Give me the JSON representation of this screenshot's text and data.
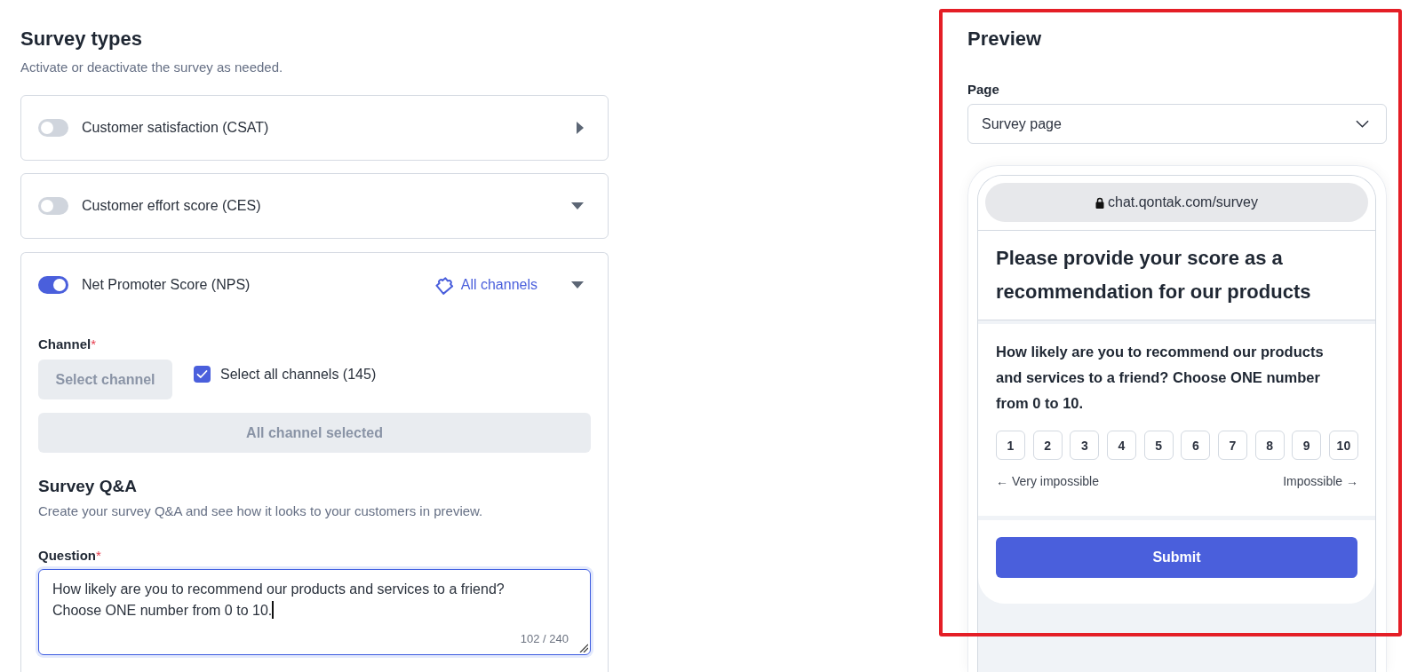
{
  "survey_types": {
    "title": "Survey types",
    "subtitle": "Activate or deactivate the survey as needed.",
    "items": [
      {
        "label": "Customer satisfaction (CSAT)",
        "on": false,
        "expanded": false
      },
      {
        "label": "Customer effort score (CES)",
        "on": false,
        "expanded": true
      },
      {
        "label": "Net Promoter Score (NPS)",
        "on": true,
        "expanded": true,
        "channels_link": "All channels",
        "details": {
          "channel": {
            "label": "Channel",
            "required_mark": "*",
            "button": {
              "label": "Select channel",
              "disabled": true
            },
            "select_all": {
              "label": "Select all channels (145)",
              "checked": true
            },
            "selected_bar": "All channel selected"
          },
          "qa": {
            "title": "Survey Q&A",
            "subtitle": "Create your survey Q&A and see how it looks to your customers in preview.",
            "question": {
              "label": "Question",
              "required_mark": "*",
              "value": "How likely are you to recommend our products and services to a friend? Choose ONE number from 0 to 10.",
              "counter": "102 / 240",
              "focused": true
            }
          }
        }
      }
    ]
  },
  "preview": {
    "title": "Preview",
    "highlighted": true,
    "page_field": {
      "label": "Page",
      "value": "Survey page"
    },
    "phone": {
      "url": "chat.qontak.com/survey",
      "heading": "Please provide your score as a recommendation for our products",
      "question": "How likely are you to recommend our products and services to a friend? Choose ONE number from 0 to 10.",
      "scores": [
        {
          "label": "1",
          "selected": false
        },
        {
          "label": "2",
          "selected": false
        },
        {
          "label": "3",
          "selected": false
        },
        {
          "label": "4",
          "selected": false
        },
        {
          "label": "5",
          "selected": false
        },
        {
          "label": "6",
          "selected": false
        },
        {
          "label": "7",
          "selected": false
        },
        {
          "label": "8",
          "selected": false
        },
        {
          "label": "9",
          "selected": false
        },
        {
          "label": "10",
          "selected": false
        }
      ],
      "low_label": "← Very impossible",
      "high_label": "Impossible →",
      "submit": "Submit"
    }
  }
}
